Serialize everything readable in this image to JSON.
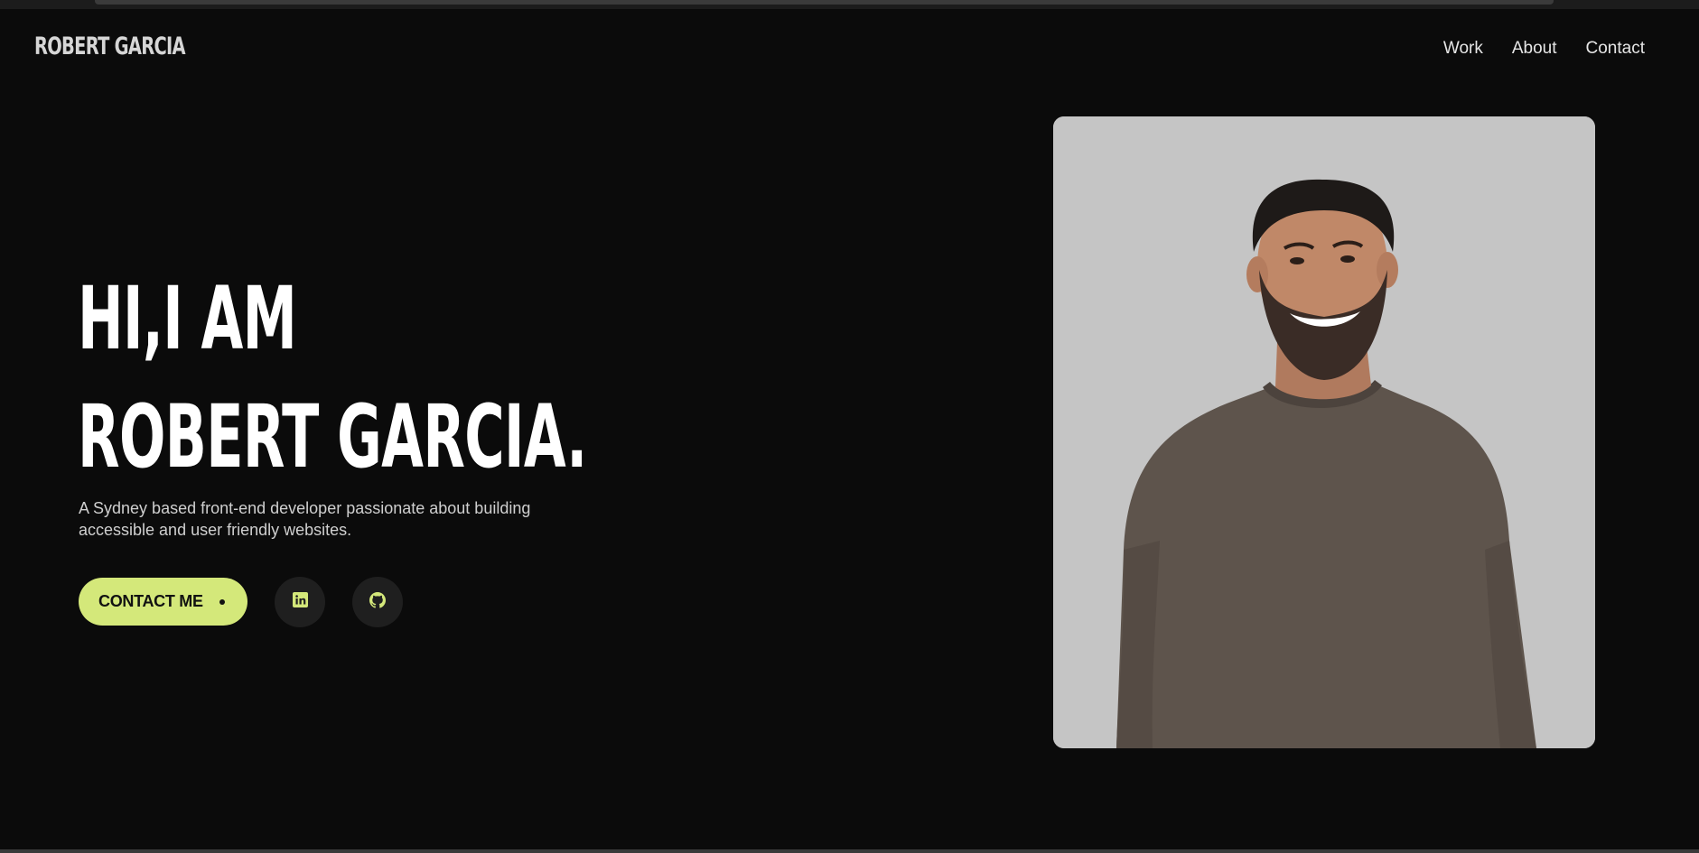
{
  "header": {
    "logo": "ROBERT GARCIA",
    "nav": [
      "Work",
      "About",
      "Contact"
    ]
  },
  "hero": {
    "line1": "HI,I AM",
    "line2": "ROBERT GARCIA.",
    "description": "A Sydney based front-end developer passionate about building accessible and user friendly websites.",
    "cta_label": "CONTACT ME",
    "social": [
      {
        "icon": "linkedin-icon"
      },
      {
        "icon": "github-icon"
      }
    ]
  },
  "colors": {
    "background": "#0b0b0b",
    "accent": "#d4e87a",
    "photo_background": "#c5c5c5",
    "sweater": "#5e544c"
  }
}
